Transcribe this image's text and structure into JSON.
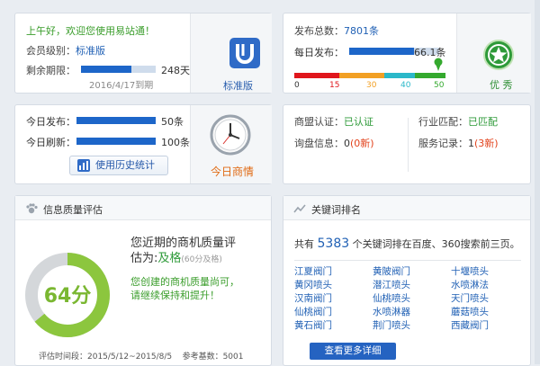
{
  "account": {
    "greeting": "上午好，欢迎您使用易站通！",
    "level_label": "会员级别：",
    "level_value": "标准版",
    "remaining_label": "剩余期限：",
    "remaining_days": "248天",
    "remaining_fraction": 0.68,
    "expiry": "2016/4/17到期",
    "badge_label": "标准版"
  },
  "publish": {
    "total_label": "发布总数：",
    "total_value": "7801条",
    "daily_label": "每日发布：",
    "daily_value": "66.1条",
    "daily_fraction": 0.72,
    "scale": [
      "0",
      "15",
      "30",
      "40",
      "50"
    ],
    "scale_colors": [
      "#e0161c",
      "#f2a024",
      "#2bb8c9",
      "#34a92e"
    ],
    "rating": "优 秀"
  },
  "today": {
    "publish_label": "今日发布：",
    "publish_value": "50条",
    "refresh_label": "今日刷新：",
    "refresh_value": "100条",
    "history_button": "使用历史统计",
    "clock_label": "今日商情"
  },
  "cert": {
    "alliance_label": "商盟认证：",
    "alliance_value": "已认证",
    "industry_label": "行业匹配：",
    "industry_value": "已匹配",
    "inquiry_label": "询盘信息：",
    "inquiry_value": "0",
    "inquiry_new": "(0新)",
    "service_label": "服务记录：",
    "service_value": "1",
    "service_new": "(3新)"
  },
  "quality": {
    "title": "信息质量评估",
    "line1": "您近期的商机质量评",
    "line2_prefix": "估为:",
    "pass": "及格",
    "note": "(60分及格)",
    "tip1": "您创建的商机质量尚可，",
    "tip2": "请继续保持和提升！",
    "score": "64分",
    "score_fraction": 0.64,
    "period": "评估时间段：2015/5/12~2015/8/5",
    "base": "参考基数：5001"
  },
  "keyword": {
    "title": "关键词排名",
    "prefix": "共有",
    "count": "5383",
    "suffix": "个关键词排在百度、360搜索前三页。",
    "items": [
      "江夏阀门",
      "黄陂阀门",
      "十堰喷头",
      "黄冈喷头",
      "潜江喷头",
      "水喷淋法",
      "汉南阀门",
      "仙桃喷头",
      "天门喷头",
      "仙桃阀门",
      "水喷淋器",
      "蘑菇喷头",
      "黄石阀门",
      "荆门喷头",
      "西藏阀门"
    ],
    "more_button": "查看更多详细"
  }
}
